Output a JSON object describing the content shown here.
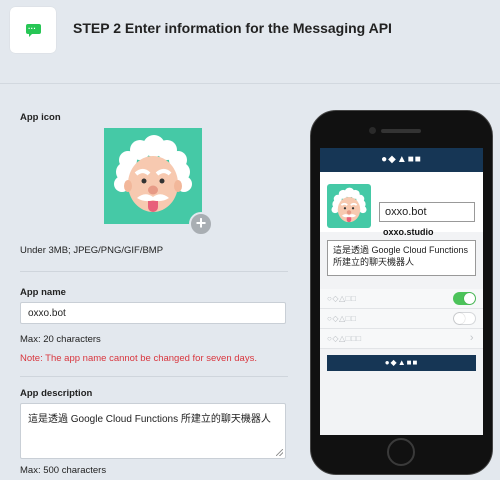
{
  "header": {
    "title": "STEP 2 Enter information for the Messaging API",
    "logo_icon": "line-chat-icon",
    "accent": "#27c655"
  },
  "form": {
    "app_icon": {
      "label": "App icon",
      "hint": "Under 3MB; JPEG/PNG/GIF/BMP",
      "add_symbol": "+"
    },
    "app_name": {
      "label": "App name",
      "value": "oxxo.bot",
      "max": "Max: 20 characters",
      "note": "Note: The app name cannot be changed for seven days."
    },
    "app_description": {
      "label": "App description",
      "value": "這是透過 Google Cloud Functions 所建立的聊天機器人",
      "max": "Max: 500 characters"
    }
  },
  "preview": {
    "top_bar": "●◆▲■■",
    "name": "oxxo.bot",
    "id": "oxxo.studio",
    "description": "這是透過 Google Cloud Functions 所建立的聊天機器人",
    "rows": [
      {
        "text": "○◇△□□",
        "control": "toggle-on"
      },
      {
        "text": "○◇△□□",
        "control": "toggle-off"
      },
      {
        "text": "○◇△□□□",
        "control": "chevron"
      }
    ],
    "button": "●◆▲■■",
    "colors": {
      "navy": "#163655",
      "toggle_on": "#4cc35a",
      "avatar_bg": "#45c9a6"
    }
  }
}
